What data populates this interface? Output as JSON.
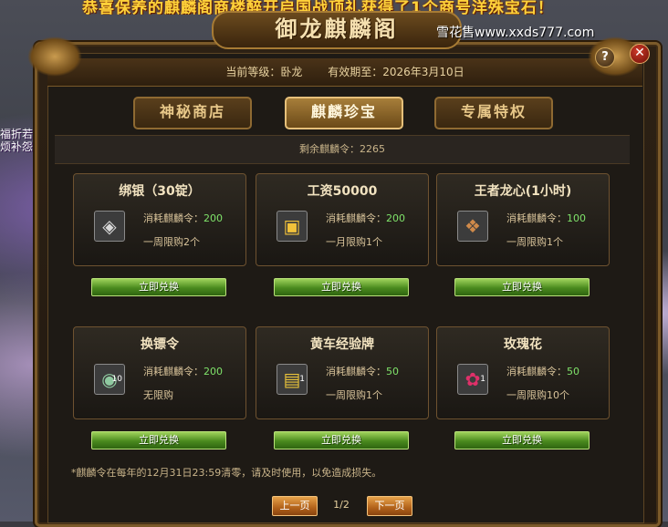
{
  "banner_text": "恭喜保养的麒麟阁商楼醉开启国战顶礼获得了1个商号洋殊宝石！",
  "watermark": "雪花售www.xxds777.com",
  "window_title": "御龙麒麟阁",
  "help_label": "?",
  "close_label": "✕",
  "header": {
    "level_text": "当前等级：卧龙",
    "expiry_text": "有效期至：2026年3月10日"
  },
  "tabs": [
    {
      "label": "神秘商店",
      "active": false
    },
    {
      "label": "麒麟珍宝",
      "active": true
    },
    {
      "label": "专属特权",
      "active": false
    }
  ],
  "remaining": "剩余麒麟令：2265",
  "items": [
    {
      "name": "绑银（30锭）",
      "icon": "silver-ingot-icon",
      "glyph": "◈",
      "qty": "",
      "cost_label": "消耗麒麟令：",
      "cost": "200",
      "limit": "一周限购2个",
      "button": "立即兑换"
    },
    {
      "name": "工资50000",
      "icon": "gold-chest-icon",
      "glyph": "▣",
      "qty": "",
      "cost_label": "消耗麒麟令：",
      "cost": "200",
      "limit": "一月限购1个",
      "button": "立即兑换"
    },
    {
      "name": "王者龙心(1小时)",
      "icon": "dragon-heart-icon",
      "glyph": "❖",
      "qty": "",
      "cost_label": "消耗麒麟令：",
      "cost": "100",
      "limit": "一周限购1个",
      "button": "立即兑换"
    },
    {
      "name": "换镖令",
      "icon": "jade-token-icon",
      "glyph": "◉",
      "qty": "10",
      "cost_label": "消耗麒麟令：",
      "cost": "200",
      "limit": "无限购",
      "button": "立即兑换"
    },
    {
      "name": "黄车经验牌",
      "icon": "cart-plaque-icon",
      "glyph": "▤",
      "qty": "1",
      "cost_label": "消耗麒麟令：",
      "cost": "50",
      "limit": "一周限购1个",
      "button": "立即兑换"
    },
    {
      "name": "玫瑰花",
      "icon": "rose-icon",
      "glyph": "✿",
      "qty": "1",
      "cost_label": "消耗麒麟令：",
      "cost": "50",
      "limit": "一周限购10个",
      "button": "立即兑换"
    }
  ],
  "footnote": "*麒麟令在每年的12月31日23:59清零，请及时使用，以免造成损失。",
  "pager": {
    "prev": "上一页",
    "page": "1/2",
    "next": "下一页"
  },
  "side_text": "福折若烦补怨"
}
